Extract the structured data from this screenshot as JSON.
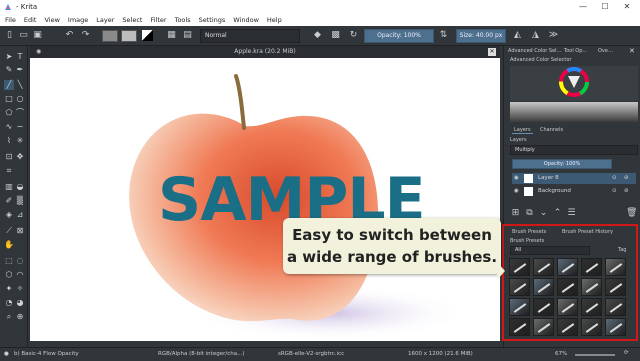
{
  "titlebar": {
    "app_title": "- Krita",
    "minimize": "—",
    "maximize": "☐",
    "close": "✕"
  },
  "menu": [
    "File",
    "Edit",
    "View",
    "Image",
    "Layer",
    "Select",
    "Filter",
    "Tools",
    "Settings",
    "Window",
    "Help"
  ],
  "toolbar": {
    "blend_mode": "Normal",
    "opacity": "Opacity: 100%",
    "size": "Size: 40.00 px"
  },
  "document": {
    "tab_title": "Apple.kra (20.2 MiB)",
    "watermark": "SAMPLE"
  },
  "dock": {
    "color_tabs": [
      "Advanced Color Sel…",
      "Tool Op…",
      "Ove…"
    ],
    "color_selector_title": "Advanced Color Selector",
    "layer_tabs": [
      "Layers",
      "Channels"
    ],
    "layers_title": "Layers",
    "layer_blend": "Multiply",
    "layer_opacity": "Opacity: 100%",
    "layers": [
      {
        "name": "Layer 8"
      },
      {
        "name": "Background"
      }
    ],
    "brush_tabs": [
      "Brush Presets",
      "Brush Preset History"
    ],
    "brush_title": "Brush Presets",
    "brush_filter": "All",
    "brush_tag": "Tag"
  },
  "callout": {
    "line1": "Easy to switch between",
    "line2": "a wide range of brushes."
  },
  "status": {
    "brush": "b) Basic-4 Flow Opacity",
    "color_space": "RGB/Alpha (8-bit integer/cha...)",
    "profile": "sRGB-elle-V2-srgbtrc.icc",
    "dims": "1600 x 1200 (21.6 MiB)",
    "zoom": "67%"
  },
  "colors": {
    "accent": "#4e708f",
    "callout_bg": "#f2f2dc",
    "highlight": "#d01818",
    "watermark": "#1a6e86"
  }
}
